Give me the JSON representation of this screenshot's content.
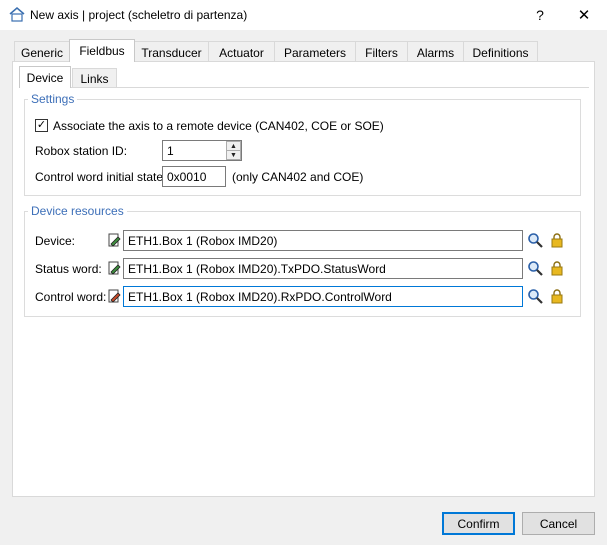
{
  "window": {
    "title": "New axis | project (scheletro di partenza)",
    "help_glyph": "?",
    "close_glyph": "✕"
  },
  "tabs": [
    {
      "label": "Generic"
    },
    {
      "label": "Fieldbus"
    },
    {
      "label": "Transducer"
    },
    {
      "label": "Actuator"
    },
    {
      "label": "Parameters"
    },
    {
      "label": "Filters"
    },
    {
      "label": "Alarms"
    },
    {
      "label": "Definitions"
    }
  ],
  "active_tab": "Fieldbus",
  "subtabs": [
    {
      "label": "Device"
    },
    {
      "label": "Links"
    }
  ],
  "active_subtab": "Device",
  "settings": {
    "title": "Settings",
    "associate_checked": true,
    "associate_label": "Associate the axis to a remote device (CAN402, COE or SOE)",
    "station_label": "Robox station ID:",
    "station_value": "1",
    "control_state_label": "Control word initial state:",
    "control_state_value": "0x0010",
    "control_state_note": "(only CAN402 and COE)"
  },
  "resources": {
    "title": "Device resources",
    "rows": [
      {
        "label": "Device:",
        "value": "ETH1.Box 1 (Robox IMD20)",
        "icon": "device-icon"
      },
      {
        "label": "Status word:",
        "value": "ETH1.Box 1 (Robox IMD20).TxPDO.StatusWord",
        "icon": "status-word-icon"
      },
      {
        "label": "Control word:",
        "value": "ETH1.Box 1 (Robox IMD20).RxPDO.ControlWord",
        "icon": "control-word-icon"
      }
    ]
  },
  "buttons": {
    "confirm": "Confirm",
    "cancel": "Cancel"
  },
  "colors": {
    "accent": "#0078d7",
    "group_title": "#3d6fb8",
    "lock": "#e8b820"
  }
}
